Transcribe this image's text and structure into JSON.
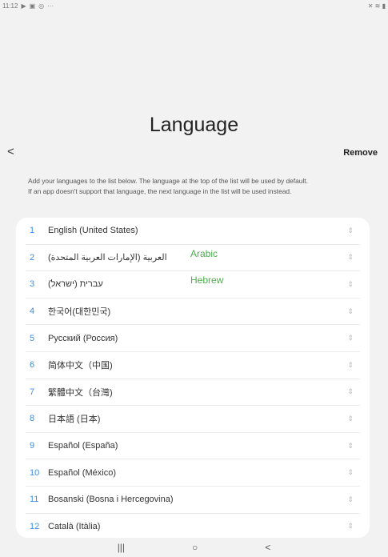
{
  "status": {
    "time": "11:12",
    "more": "···"
  },
  "title": "Language",
  "remove_label": "Remove",
  "description": [
    "Add your languages to the list below. The language at the top of the list will be used by default.",
    "If an app doesn't support that language, the next language in the list will be used instead."
  ],
  "languages": [
    {
      "num": "1",
      "name": "English (United States)"
    },
    {
      "num": "2",
      "name": "العربية (الإمارات العربية المتحدة)",
      "note": "Arabic"
    },
    {
      "num": "3",
      "name": "עברית (ישראל)",
      "note": "Hebrew"
    },
    {
      "num": "4",
      "name": "한국어(대한민국)"
    },
    {
      "num": "5",
      "name": "Русский (Россия)"
    },
    {
      "num": "6",
      "name": "简体中文（中国)"
    },
    {
      "num": "7",
      "name": "繁體中文（台灣)"
    },
    {
      "num": "8",
      "name": "日本語 (日本)"
    },
    {
      "num": "9",
      "name": "Español (España)"
    },
    {
      "num": "10",
      "name": "Español (México)"
    },
    {
      "num": "11",
      "name": "Bosanski (Bosna i Hercegovina)"
    },
    {
      "num": "12",
      "name": "Català (Itàlia)"
    }
  ],
  "colors": {
    "accent": "#3e8ee0",
    "note": "#4cae4c"
  }
}
